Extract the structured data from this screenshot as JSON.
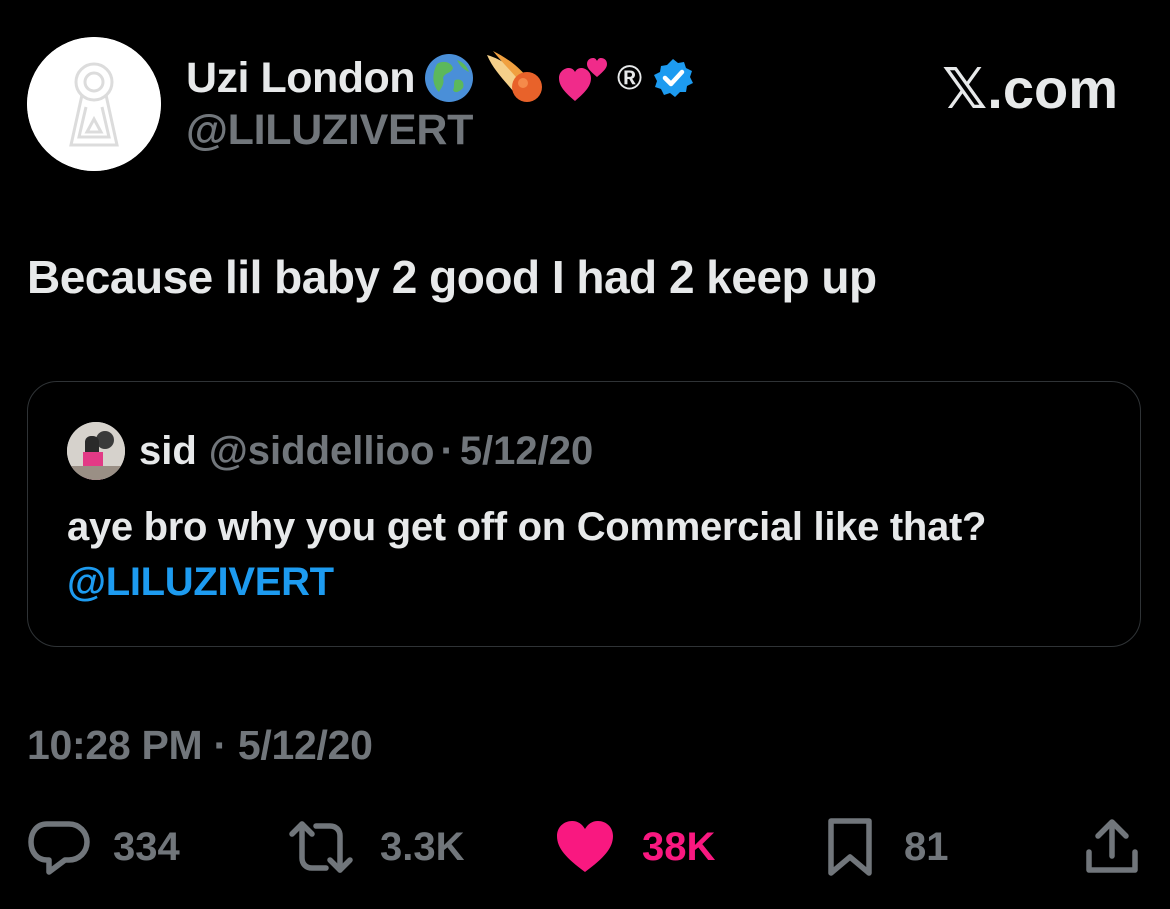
{
  "brand": {
    "label": "𝕏.com"
  },
  "author": {
    "display_name": "Uzi London",
    "name_emojis": [
      "globe-americas-icon",
      "comet-icon",
      "two-hearts-icon"
    ],
    "registered_mark": "®",
    "verified": true,
    "handle": "@LILUZIVERT"
  },
  "tweet": {
    "text": "Because lil baby 2 good I had 2 keep up",
    "timestamp": "10:28 PM · 5/12/20"
  },
  "quote": {
    "name": "sid",
    "handle": "@siddellioo",
    "separator": "·",
    "date": "5/12/20",
    "text_before": "aye bro why you get off on Commercial like that?",
    "mention": "@LILUZIVERT"
  },
  "actions": {
    "replies": "334",
    "reposts": "3.3K",
    "likes": "38K",
    "bookmarks": "81"
  },
  "colors": {
    "background": "#000000",
    "text": "#e7e9ea",
    "muted": "#71767b",
    "link": "#1d9bf0",
    "like": "#f91880",
    "verified": "#1d9bf0"
  }
}
